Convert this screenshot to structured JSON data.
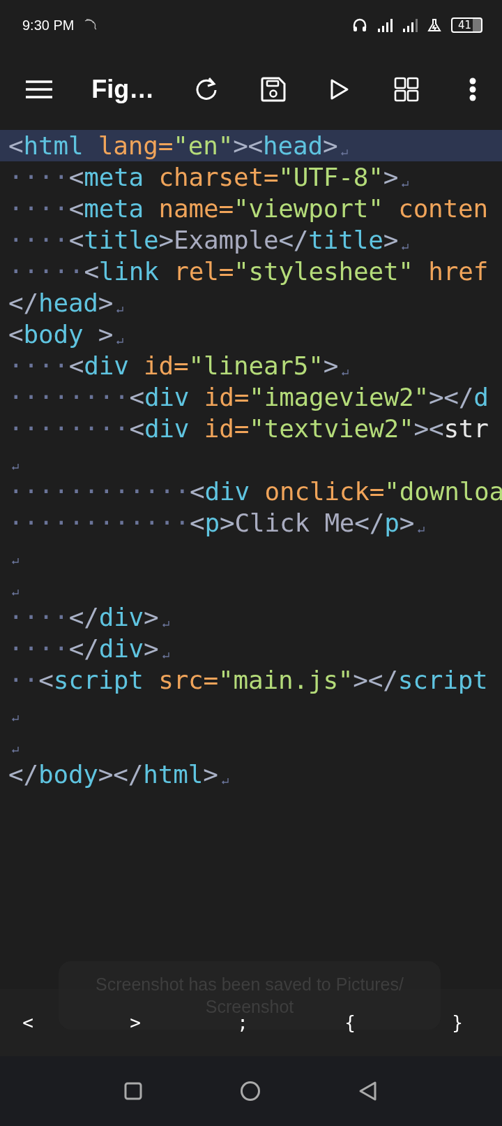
{
  "status_bar": {
    "time": "9:30 PM",
    "battery": "41"
  },
  "toolbar": {
    "title": "Fig…"
  },
  "editor": {
    "lines": [
      {
        "selected": true,
        "ret": true,
        "tokens": [
          {
            "kind": "punct",
            "text": "<"
          },
          {
            "kind": "tag",
            "text": "html"
          },
          {
            "kind": "attr",
            "text": " lang="
          },
          {
            "kind": "string",
            "text": "\"en\""
          },
          {
            "kind": "punct",
            "text": "><"
          },
          {
            "kind": "tag",
            "text": "head"
          },
          {
            "kind": "punct",
            "text": ">"
          }
        ]
      },
      {
        "indent": "····",
        "selected": false,
        "ret": true,
        "tokens": [
          {
            "kind": "punct",
            "text": "<"
          },
          {
            "kind": "tag",
            "text": "meta"
          },
          {
            "kind": "attr",
            "text": " charset="
          },
          {
            "kind": "string",
            "text": "\"UTF-8\""
          },
          {
            "kind": "punct",
            "text": ">"
          }
        ]
      },
      {
        "indent": "····",
        "selected": false,
        "ret": false,
        "tokens": [
          {
            "kind": "punct",
            "text": "<"
          },
          {
            "kind": "tag",
            "text": "meta"
          },
          {
            "kind": "attr",
            "text": " name="
          },
          {
            "kind": "string",
            "text": "\"viewport\""
          },
          {
            "kind": "attr",
            "text": " conten"
          }
        ]
      },
      {
        "indent": "····",
        "selected": false,
        "ret": true,
        "tokens": [
          {
            "kind": "punct",
            "text": "<"
          },
          {
            "kind": "tag",
            "text": "title"
          },
          {
            "kind": "punct",
            "text": ">"
          },
          {
            "kind": "text",
            "text": "Example"
          },
          {
            "kind": "punct",
            "text": "</"
          },
          {
            "kind": "tag",
            "text": "title"
          },
          {
            "kind": "punct",
            "text": ">"
          }
        ]
      },
      {
        "indent": "·····",
        "selected": false,
        "ret": false,
        "tokens": [
          {
            "kind": "punct",
            "text": "<"
          },
          {
            "kind": "tag",
            "text": "link"
          },
          {
            "kind": "attr",
            "text": " rel="
          },
          {
            "kind": "string",
            "text": "\"stylesheet\""
          },
          {
            "kind": "attr",
            "text": " href"
          }
        ]
      },
      {
        "selected": false,
        "ret": true,
        "tokens": [
          {
            "kind": "punct",
            "text": "</"
          },
          {
            "kind": "tag",
            "text": "head"
          },
          {
            "kind": "punct",
            "text": ">"
          }
        ]
      },
      {
        "selected": false,
        "ret": true,
        "tokens": [
          {
            "kind": "punct",
            "text": "<"
          },
          {
            "kind": "tag",
            "text": "body"
          },
          {
            "kind": "punct",
            "text": " >"
          }
        ]
      },
      {
        "indent": "····",
        "selected": false,
        "ret": true,
        "tokens": [
          {
            "kind": "punct",
            "text": "<"
          },
          {
            "kind": "tag",
            "text": "div"
          },
          {
            "kind": "attr",
            "text": " id="
          },
          {
            "kind": "string",
            "text": "\"linear5\""
          },
          {
            "kind": "punct",
            "text": ">"
          }
        ]
      },
      {
        "indent": "········",
        "selected": false,
        "ret": false,
        "tokens": [
          {
            "kind": "punct",
            "text": "<"
          },
          {
            "kind": "tag",
            "text": "div"
          },
          {
            "kind": "attr",
            "text": " id="
          },
          {
            "kind": "string",
            "text": "\"imageview2\""
          },
          {
            "kind": "punct",
            "text": "></"
          },
          {
            "kind": "tag",
            "text": "d"
          }
        ]
      },
      {
        "indent": "········",
        "selected": false,
        "ret": false,
        "tokens": [
          {
            "kind": "punct",
            "text": "<"
          },
          {
            "kind": "tag",
            "text": "div"
          },
          {
            "kind": "attr",
            "text": " id="
          },
          {
            "kind": "string",
            "text": "\"textview2\""
          },
          {
            "kind": "punct",
            "text": "><"
          },
          {
            "kind": "plain",
            "text": "str"
          }
        ]
      },
      {
        "selected": false,
        "ret": true
      },
      {
        "indent": "············",
        "selected": false,
        "ret": false,
        "tokens": [
          {
            "kind": "punct",
            "text": "<"
          },
          {
            "kind": "tag",
            "text": "div"
          },
          {
            "kind": "attr",
            "text": " onclick="
          },
          {
            "kind": "string",
            "text": "\"downloa"
          }
        ]
      },
      {
        "indent": "············",
        "selected": false,
        "ret": true,
        "tokens": [
          {
            "kind": "punct",
            "text": "<"
          },
          {
            "kind": "tag",
            "text": "p"
          },
          {
            "kind": "punct",
            "text": ">"
          },
          {
            "kind": "text",
            "text": "Click Me"
          },
          {
            "kind": "punct",
            "text": "</"
          },
          {
            "kind": "tag",
            "text": "p"
          },
          {
            "kind": "punct",
            "text": ">"
          }
        ]
      },
      {
        "selected": false,
        "ret": true
      },
      {
        "selected": false,
        "ret": true
      },
      {
        "indent": "····",
        "selected": false,
        "ret": true,
        "tokens": [
          {
            "kind": "punct",
            "text": "</"
          },
          {
            "kind": "tag",
            "text": "div"
          },
          {
            "kind": "punct",
            "text": ">"
          }
        ]
      },
      {
        "indent": "····",
        "selected": false,
        "ret": true,
        "tokens": [
          {
            "kind": "punct",
            "text": "</"
          },
          {
            "kind": "tag",
            "text": "div"
          },
          {
            "kind": "punct",
            "text": ">"
          }
        ]
      },
      {
        "indent": "··",
        "selected": false,
        "ret": false,
        "tokens": [
          {
            "kind": "punct",
            "text": "<"
          },
          {
            "kind": "tag",
            "text": "script"
          },
          {
            "kind": "attr",
            "text": " src="
          },
          {
            "kind": "string",
            "text": "\"main.js\""
          },
          {
            "kind": "punct",
            "text": "></"
          },
          {
            "kind": "tag",
            "text": "script"
          }
        ]
      },
      {
        "selected": false,
        "ret": true
      },
      {
        "selected": false,
        "ret": true
      },
      {
        "selected": false,
        "ret": true,
        "tokens": [
          {
            "kind": "punct",
            "text": "</"
          },
          {
            "kind": "tag",
            "text": "body"
          },
          {
            "kind": "punct",
            "text": "></"
          },
          {
            "kind": "tag",
            "text": "html"
          },
          {
            "kind": "punct",
            "text": ">"
          }
        ]
      }
    ]
  },
  "toast": {
    "text": "Screenshot has been saved to  Pictures/ Screenshot"
  },
  "symbol_keys": [
    "<",
    ">",
    ";",
    "{",
    "}"
  ]
}
